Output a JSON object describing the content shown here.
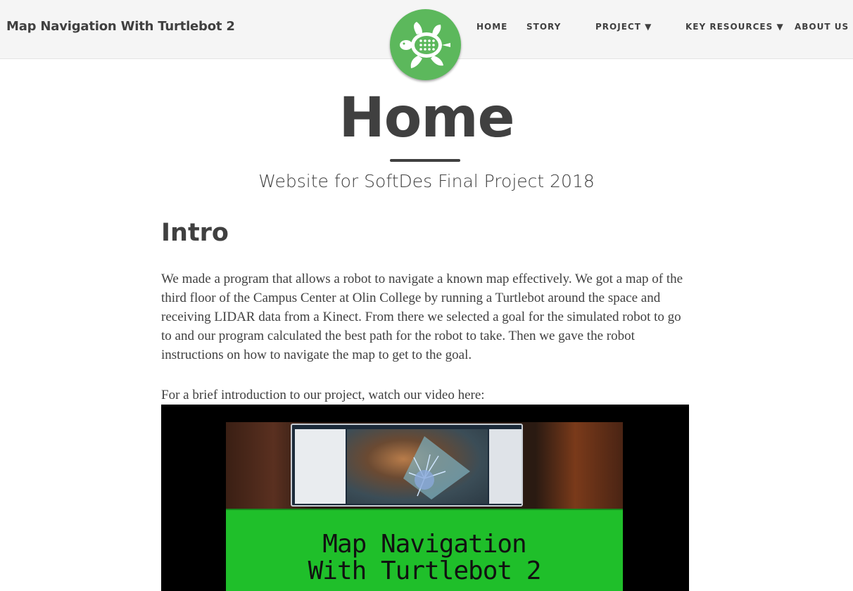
{
  "navbar": {
    "brand": "Map Navigation With Turtlebot 2",
    "links": [
      {
        "label": "HOME"
      },
      {
        "label": "STORY"
      },
      {
        "label": "PROJECT ▼"
      },
      {
        "label": "KEY RESOURCES ▼"
      },
      {
        "label": "ABOUT US"
      }
    ],
    "logo_icon": "turtle-icon"
  },
  "header": {
    "title": "Home",
    "subtitle": "Website for SoftDes Final Project 2018"
  },
  "content": {
    "section_heading": "Intro",
    "paragraph": "We made a program that allows a robot to navigate a known map effectively. We got a map of the third floor of the Campus Center at Olin College by running a Turtlebot around the space and receiving LIDAR data from a Kinect. From there we selected a goal for the simulated robot to go to and our program calculated the best path for the robot to take. Then we gave the robot instructions on how to navigate the map to get to the goal.",
    "video_caption": "For a brief introduction to our project, watch our video here:",
    "video": {
      "banner_line_1": "Map Navigation",
      "banner_line_2": "With Turtlebot 2"
    }
  },
  "colors": {
    "navbar_bg": "#f5f5f5",
    "text": "#404040",
    "logo_green": "#5cb85c",
    "banner_green": "#1fbf2a"
  }
}
